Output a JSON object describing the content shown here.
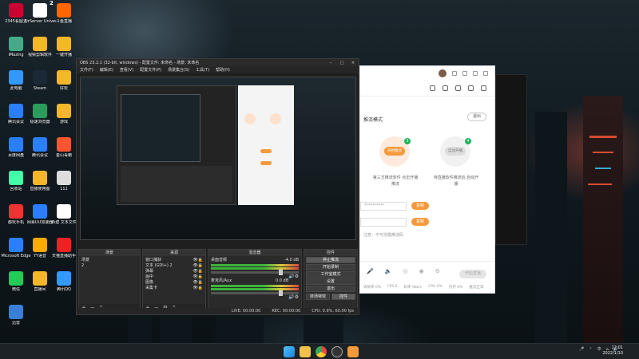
{
  "desktop": {
    "icons": [
      {
        "label": "2345看图王"
      },
      {
        "label": "AirServer Univers..."
      },
      {
        "label": "斗鱼直播"
      },
      {
        "label": "iMazing"
      },
      {
        "label": "视频剪辑软件"
      },
      {
        "label": "一键开播"
      },
      {
        "label": "此电脑"
      },
      {
        "label": "Steam"
      },
      {
        "label": "好玩"
      },
      {
        "label": "腾讯会议"
      },
      {
        "label": "极速浏览器"
      },
      {
        "label": "游戏"
      },
      {
        "label": "百度网盘"
      },
      {
        "label": "腾讯会议"
      },
      {
        "label": "金山毒霸"
      },
      {
        "label": "回收站"
      },
      {
        "label": "直播使用图"
      },
      {
        "label": "111"
      },
      {
        "label": "都玩手机"
      },
      {
        "label": "网易UU加速器"
      },
      {
        "label": "新建 文本文件"
      },
      {
        "label": "Microsoft Edge"
      },
      {
        "label": "YY语音"
      },
      {
        "label": "天猫直播助手"
      },
      {
        "label": "微信"
      },
      {
        "label": "直播间"
      },
      {
        "label": "腾讯QQ"
      },
      {
        "label": "迅雷"
      }
    ],
    "badge_number": "2"
  },
  "obs": {
    "title": "OBS 23.2.1 (32-bit, windows) - 配置文件: 未命名 - 场景: 未命名",
    "menu": [
      "文件(F)",
      "编辑(E)",
      "查看(V)",
      "配置文件(P)",
      "场景集合(S)",
      "工具(T)",
      "帮助(H)"
    ],
    "docks": {
      "scenes": {
        "title": "场景",
        "items": [
          "场景",
          "2"
        ]
      },
      "sources": {
        "title": "来源",
        "items": [
          "窗口捕获",
          "文本 (GDI+) 2",
          "弹幕",
          "画中",
          "图像",
          "采集卡"
        ]
      },
      "mixer": {
        "title": "混音器",
        "tracks": [
          {
            "name": "桌面音频",
            "db": "-4.0 dB"
          },
          {
            "name": "麦克风/Aux",
            "db": "0.0 dB"
          }
        ]
      },
      "controls": {
        "title": "控件",
        "buttons": [
          "停止推流",
          "开始录制",
          "工作室模式",
          "设置",
          "退出"
        ],
        "transition_label": "转场特效",
        "transition_value": "控件"
      }
    },
    "status": {
      "live": "LIVE: 00:00:00",
      "rec": "REC: 00:00:00",
      "cpu": "CPU: 0.9%, 60.00 fps"
    }
  },
  "app": {
    "mode_label": "推流模式",
    "exit_label": "退出",
    "option_left": {
      "button": "开始推流",
      "badge": "3",
      "desc": "第三方推流软件 点击开播推流"
    },
    "option_right": {
      "button": "自动开播",
      "badge": "4",
      "desc": "待直播软件推流后 自动开播"
    },
    "fields": [
      {
        "value": "**********",
        "button": "复制"
      },
      {
        "value": "",
        "button": "复制"
      }
    ],
    "hint": "注意：不可泄露推流码",
    "start_live": "开始直播",
    "stats": [
      "丢帧率 0%",
      "FPS 0",
      "码率 0kb/s",
      "CPU 0%",
      "内存 0%",
      "推流正常"
    ]
  },
  "taskbar": {
    "time": "12:01",
    "date": "2022/1/10",
    "lang": "中",
    "apps": [
      "windows-start-icon",
      "file-explorer-icon",
      "chrome-icon",
      "obs-icon",
      "app-icon"
    ]
  }
}
